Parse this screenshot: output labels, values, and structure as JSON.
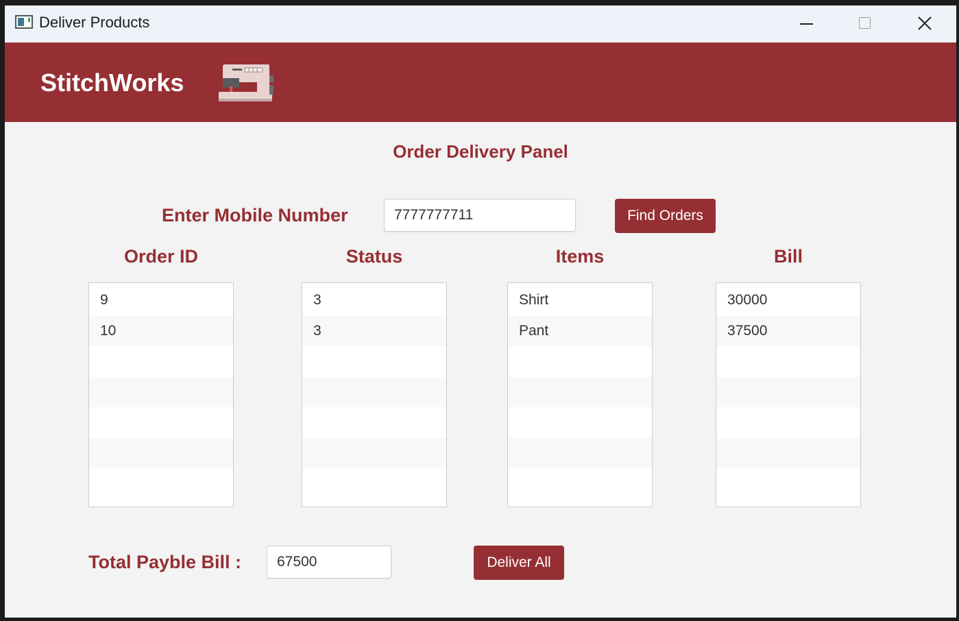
{
  "window": {
    "title": "Deliver Products"
  },
  "header": {
    "brand": "StitchWorks",
    "logo_icon": "sewing-machine-icon"
  },
  "panel": {
    "title": "Order Delivery Panel",
    "mobile_label": "Enter Mobile Number",
    "mobile_value": "7777777711",
    "find_button": "Find Orders"
  },
  "table": {
    "columns": [
      "Order ID",
      "Status",
      "Items",
      "Bill"
    ],
    "rows": [
      {
        "order_id": "9",
        "status": "3",
        "item": "Shirt",
        "bill": "30000"
      },
      {
        "order_id": "10",
        "status": "3",
        "item": "Pant",
        "bill": "37500"
      }
    ]
  },
  "footer": {
    "total_label": "Total Payble Bill :",
    "total_value": "67500",
    "deliver_button": "Deliver All"
  },
  "colors": {
    "accent": "#962f33",
    "background": "#f3f3f3"
  }
}
